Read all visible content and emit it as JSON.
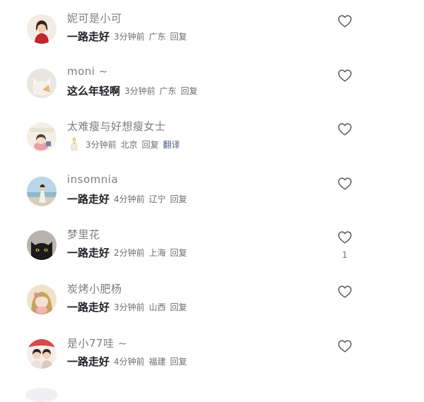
{
  "comments": [
    {
      "username": "妮可是小可",
      "text": "一路走好",
      "time": "3分钟前",
      "location": "广东",
      "reply": "回复",
      "avatar": "avatar-woman-red-icon"
    },
    {
      "username": "moni ~",
      "text": "这么年轻啊",
      "time": "3分钟前",
      "location": "广东",
      "reply": "回复",
      "avatar": "avatar-cat-icon"
    },
    {
      "username": "太难瘦与好想瘦女士",
      "text": "",
      "sticker": "candle-icon",
      "time": "3分钟前",
      "location": "北京",
      "reply": "回复",
      "translate": "翻译",
      "avatar": "avatar-cartoon-girl-icon"
    },
    {
      "username": "insomnia",
      "text": "一路走好",
      "time": "4分钟前",
      "location": "辽宁",
      "reply": "回复",
      "avatar": "avatar-beach-girl-icon"
    },
    {
      "username": "梦里花",
      "text": "一路走好",
      "time": "2分钟前",
      "location": "上海",
      "reply": "回复",
      "likes": "1",
      "avatar": "avatar-black-cat-icon"
    },
    {
      "username": "炭烤小肥杨",
      "text": "一路走好",
      "time": "3分钟前",
      "location": "山西",
      "reply": "回复",
      "avatar": "avatar-anime-girl-icon"
    },
    {
      "username": "是小77哇 ~",
      "text": "一路走好",
      "time": "4分钟前",
      "location": "福建",
      "reply": "回复",
      "avatar": "avatar-couple-icon"
    }
  ]
}
